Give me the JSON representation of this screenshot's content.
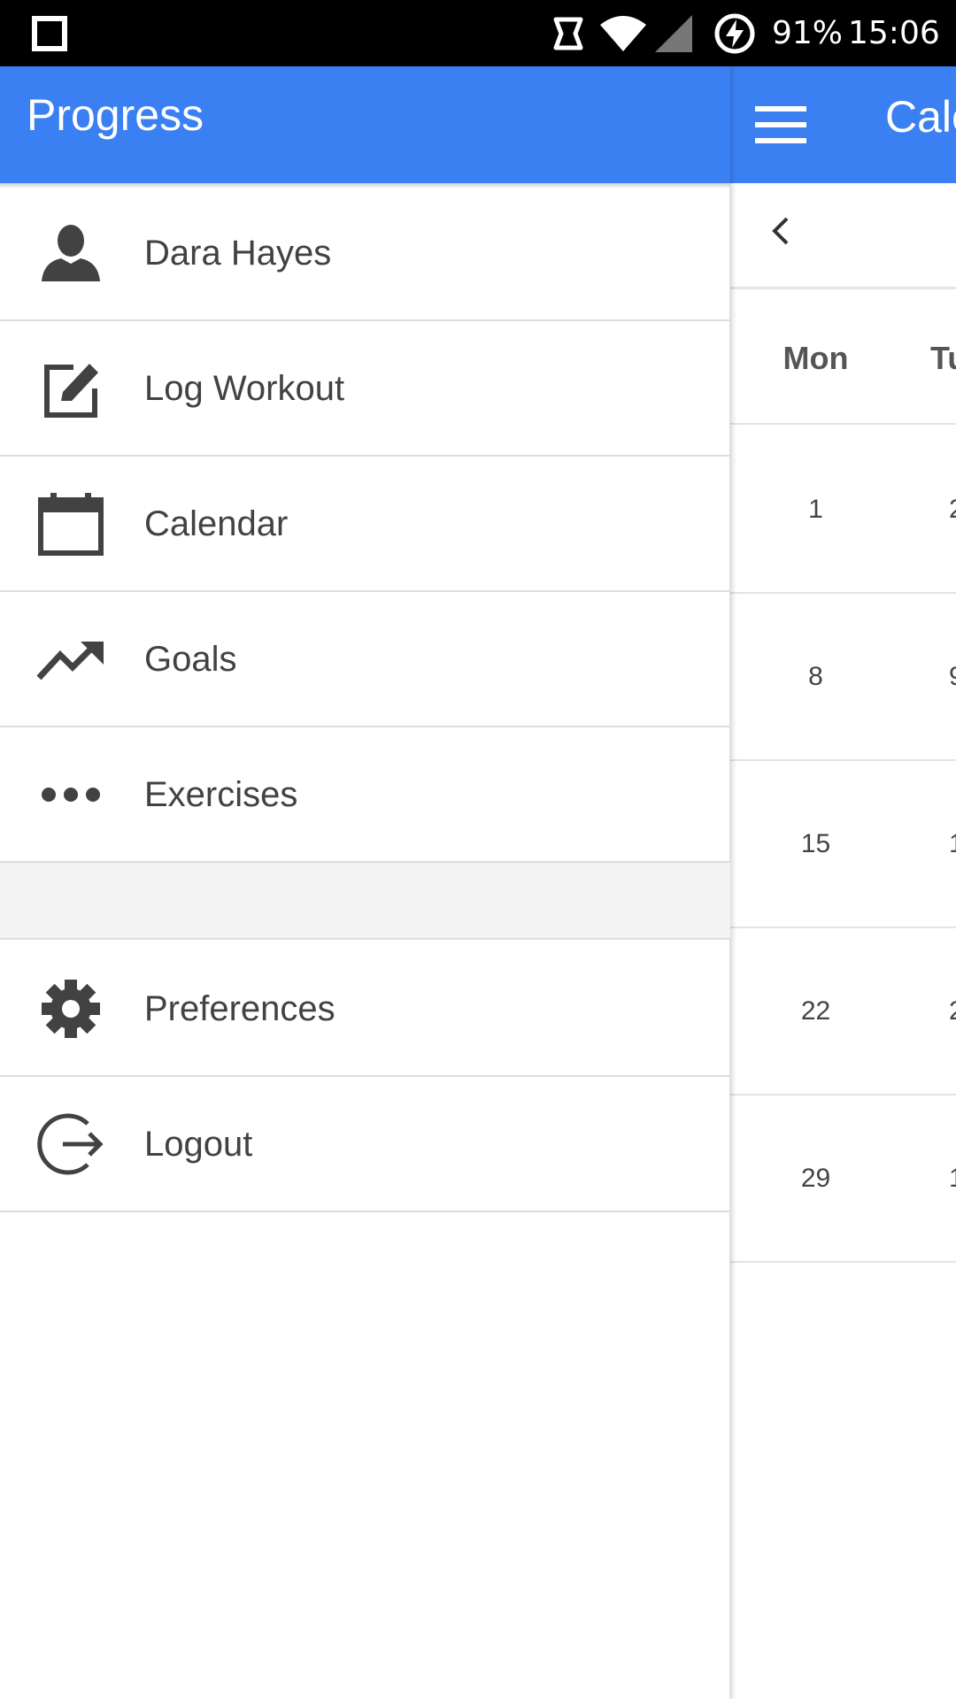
{
  "status_bar": {
    "battery": "91%",
    "time": "15:06"
  },
  "drawer": {
    "title": "Progress",
    "items": [
      {
        "label": "Dara Hayes",
        "icon": "person-icon"
      },
      {
        "label": "Log Workout",
        "icon": "edit-icon"
      },
      {
        "label": "Calendar",
        "icon": "calendar-icon"
      },
      {
        "label": "Goals",
        "icon": "trending-up-icon"
      },
      {
        "label": "Exercises",
        "icon": "more-horiz-icon"
      }
    ],
    "bottom_items": [
      {
        "label": "Preferences",
        "icon": "gear-icon"
      },
      {
        "label": "Logout",
        "icon": "logout-icon"
      }
    ]
  },
  "calendar": {
    "title": "Cale",
    "day_labels": [
      "Mon",
      "Tu"
    ],
    "weeks": [
      [
        "1",
        "2"
      ],
      [
        "8",
        "9"
      ],
      [
        "15",
        "1"
      ],
      [
        "22",
        "2"
      ],
      [
        "29",
        "1"
      ]
    ]
  },
  "colors": {
    "app_bar": "#3b80f3",
    "status_bar": "#000000",
    "text": "#424242"
  }
}
